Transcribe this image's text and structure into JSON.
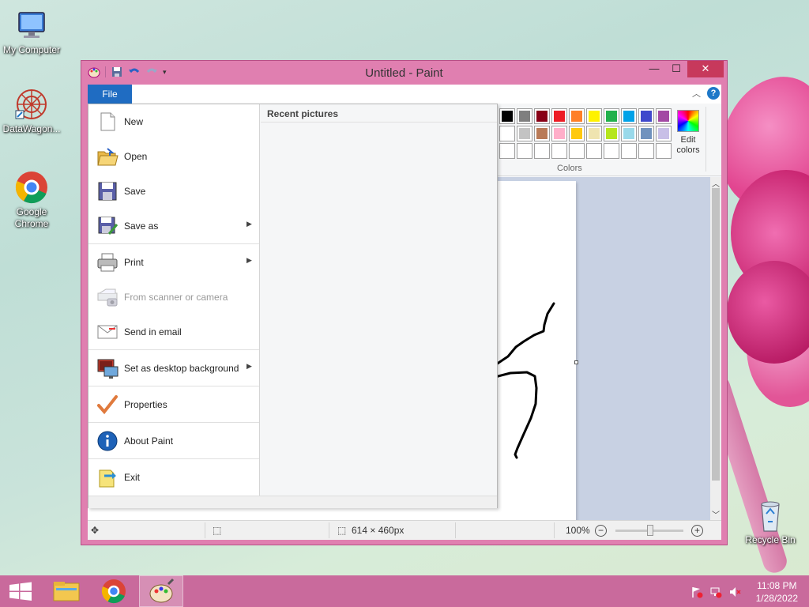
{
  "desktop": {
    "icons": [
      {
        "label": "My Computer"
      },
      {
        "label": "DataWagon..."
      },
      {
        "label": "Google Chrome"
      },
      {
        "label": "Recycle Bin"
      }
    ]
  },
  "window": {
    "title": "Untitled - Paint",
    "controls": {
      "minimize": "—",
      "maximize": "☐",
      "close": "✕"
    }
  },
  "ribbon": {
    "file_tab": "File",
    "colors_group_label": "Colors",
    "edit_colors_label": "Edit colors",
    "palette_row1": [
      "#000000",
      "#7f7f7f",
      "#880015",
      "#ed1c24",
      "#ff7f27",
      "#fff200",
      "#22b14c",
      "#00a2e8",
      "#3f48cc",
      "#a349a4"
    ],
    "palette_row2": [
      "#ffffff",
      "#c3c3c3",
      "#b97a57",
      "#ffaec9",
      "#ffc90e",
      "#efe4b0",
      "#b5e61d",
      "#99d9ea",
      "#7092be",
      "#c8bfe7"
    ],
    "palette_row3": [
      "#ffffff",
      "#ffffff",
      "#ffffff",
      "#ffffff",
      "#ffffff",
      "#ffffff",
      "#ffffff",
      "#ffffff",
      "#ffffff",
      "#ffffff"
    ]
  },
  "file_menu": {
    "items": [
      {
        "label": "New",
        "has_submenu": false,
        "enabled": true
      },
      {
        "label": "Open",
        "has_submenu": false,
        "enabled": true
      },
      {
        "label": "Save",
        "has_submenu": false,
        "enabled": true
      },
      {
        "label": "Save as",
        "has_submenu": true,
        "enabled": true
      },
      {
        "label": "Print",
        "has_submenu": true,
        "enabled": true
      },
      {
        "label": "From scanner or camera",
        "has_submenu": false,
        "enabled": false
      },
      {
        "label": "Send in email",
        "has_submenu": false,
        "enabled": true
      },
      {
        "label": "Set as desktop background",
        "has_submenu": true,
        "enabled": true
      },
      {
        "label": "Properties",
        "has_submenu": false,
        "enabled": true
      },
      {
        "label": "About Paint",
        "has_submenu": false,
        "enabled": true
      },
      {
        "label": "Exit",
        "has_submenu": false,
        "enabled": true
      }
    ],
    "recent_pictures_title": "Recent pictures"
  },
  "statusbar": {
    "image_size": "614 × 460px",
    "zoom": "100%",
    "zoom_level": 100
  },
  "taskbar": {
    "time": "11:08 PM",
    "date": "1/28/2022"
  }
}
